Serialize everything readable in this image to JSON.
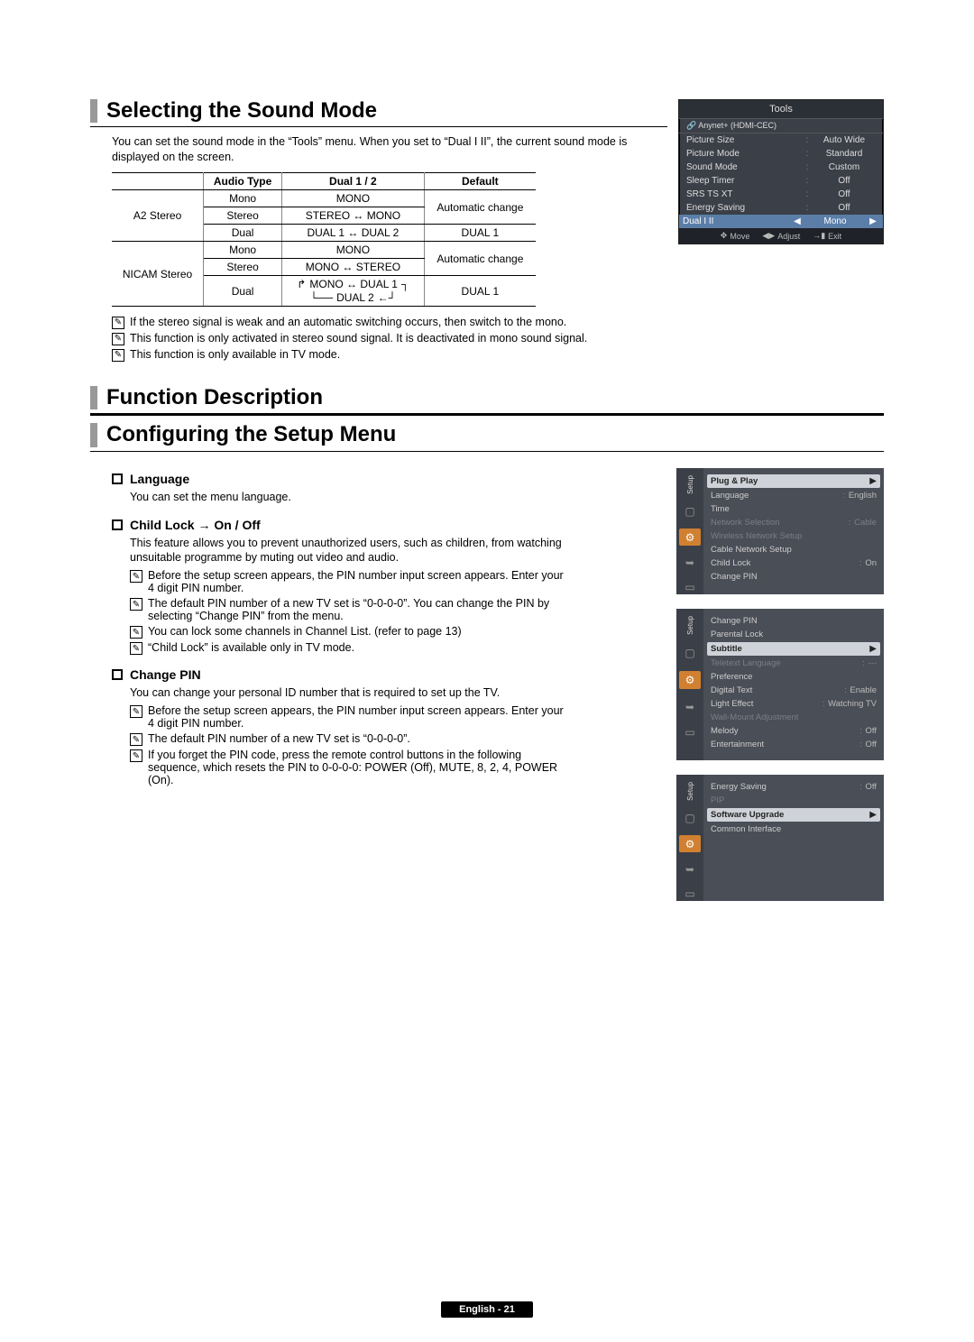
{
  "section1": {
    "title": "Selecting the Sound Mode",
    "desc": "You can set the sound mode in the “Tools” menu. When you set to “Dual I II”, the current sound mode is displayed on the screen.",
    "table": {
      "headers": [
        "",
        "Audio Type",
        "Dual 1 / 2",
        "Default"
      ],
      "rows_a2": {
        "group": "A2 Stereo",
        "mono": {
          "type": "Mono",
          "dual": "MONO",
          "default": "Automatic change"
        },
        "stereo": {
          "type": "Stereo",
          "dual": "STEREO ↔ MONO",
          "default_span": true
        },
        "dual": {
          "type": "Dual",
          "dual": "DUAL 1 ↔ DUAL 2",
          "default": "DUAL 1"
        }
      },
      "rows_nicam": {
        "group": "NICAM Stereo",
        "mono": {
          "type": "Mono",
          "dual": "MONO",
          "default": "Automatic change"
        },
        "stereo": {
          "type": "Stereo",
          "dual": "MONO ↔ STEREO",
          "default_span": true
        },
        "dual": {
          "type": "Dual",
          "dual_top": "MONO ↔ DUAL 1",
          "dual_bottom": "DUAL 2",
          "default": "DUAL 1"
        }
      }
    },
    "notes": [
      "If the stereo signal is weak and an automatic switching occurs, then switch to the mono.",
      "This function is only activated in stereo sound signal. It is deactivated in mono sound signal.",
      "This function is only available in TV mode."
    ],
    "osd": {
      "title": "Tools",
      "anynet": "Anynet+ (HDMI-CEC)",
      "rows": [
        {
          "label": "Picture Size",
          "value": "Auto Wide"
        },
        {
          "label": "Picture Mode",
          "value": "Standard"
        },
        {
          "label": "Sound Mode",
          "value": "Custom"
        },
        {
          "label": "Sleep Timer",
          "value": "Off"
        },
        {
          "label": "SRS TS XT",
          "value": "Off"
        },
        {
          "label": "Energy Saving",
          "value": "Off"
        }
      ],
      "highlight": {
        "label": "Dual I II",
        "value": "Mono"
      },
      "foot_move": "Move",
      "foot_adjust": "Adjust",
      "foot_exit": "Exit"
    }
  },
  "section2": {
    "title": "Function Description",
    "subtitle": "Configuring the Setup Menu",
    "language": {
      "head": "Language",
      "desc": "You can set the menu language."
    },
    "childlock": {
      "head": "Child Lock → On / Off",
      "desc": "This feature allows you to prevent unauthorized users, such as children, from watching unsuitable programme by muting out video and audio.",
      "notes": [
        "Before the setup screen appears, the PIN number input screen appears. Enter your 4 digit PIN number.",
        "The default PIN number of a new TV set is “0-0-0-0”. You can change the PIN by selecting “Change PIN” from the menu.",
        "You can lock some channels in Channel List. (refer to page 13)",
        "“Child Lock” is available only in TV mode."
      ]
    },
    "changepin": {
      "head": "Change PIN",
      "desc": "You can change your personal ID number that is required to set up the TV.",
      "notes": [
        "Before the setup screen appears, the PIN number input screen appears. Enter your 4 digit PIN number.",
        "The default PIN number of a new TV set is “0-0-0-0”.",
        "If you forget the PIN code, press the remote control buttons in the following sequence, which resets the PIN to 0-0-0-0: POWER (Off), MUTE, 8, 2, 4, POWER (On)."
      ]
    },
    "panels": [
      {
        "tab": "Setup",
        "rows": [
          {
            "label": "Plug & Play",
            "highlight": true,
            "chev": true
          },
          {
            "label": "Language",
            "value": "English"
          },
          {
            "label": "Time",
            "value": ""
          },
          {
            "label": "Network Selection",
            "value": "Cable",
            "dim": true
          },
          {
            "label": "Wireless Network Setup",
            "value": "",
            "dim": true
          },
          {
            "label": "Cable Network Setup",
            "value": ""
          },
          {
            "label": "Child Lock",
            "value": "On"
          },
          {
            "label": "Change PIN",
            "value": ""
          }
        ]
      },
      {
        "tab": "Setup",
        "rows": [
          {
            "label": "Change PIN",
            "value": ""
          },
          {
            "label": "Parental Lock",
            "value": ""
          },
          {
            "label": "Subtitle",
            "highlight": true,
            "chev": true
          },
          {
            "label": "Teletext Language",
            "value": "---",
            "dim": true
          },
          {
            "label": "Preference",
            "value": ""
          },
          {
            "label": "Digital Text",
            "value": "Enable"
          },
          {
            "label": "Light Effect",
            "value": "Watching TV"
          },
          {
            "label": "Wall-Mount Adjustment",
            "value": "",
            "dim": true
          },
          {
            "label": "Melody",
            "value": "Off"
          },
          {
            "label": "Entertainment",
            "value": "Off"
          }
        ]
      },
      {
        "tab": "Setup",
        "rows": [
          {
            "label": "Energy Saving",
            "value": "Off"
          },
          {
            "label": "PIP",
            "value": "",
            "dim": true
          },
          {
            "label": "Software Upgrade",
            "highlight": true,
            "chev": true
          },
          {
            "label": "Common Interface",
            "value": ""
          }
        ]
      }
    ]
  },
  "footer": "English - 21"
}
